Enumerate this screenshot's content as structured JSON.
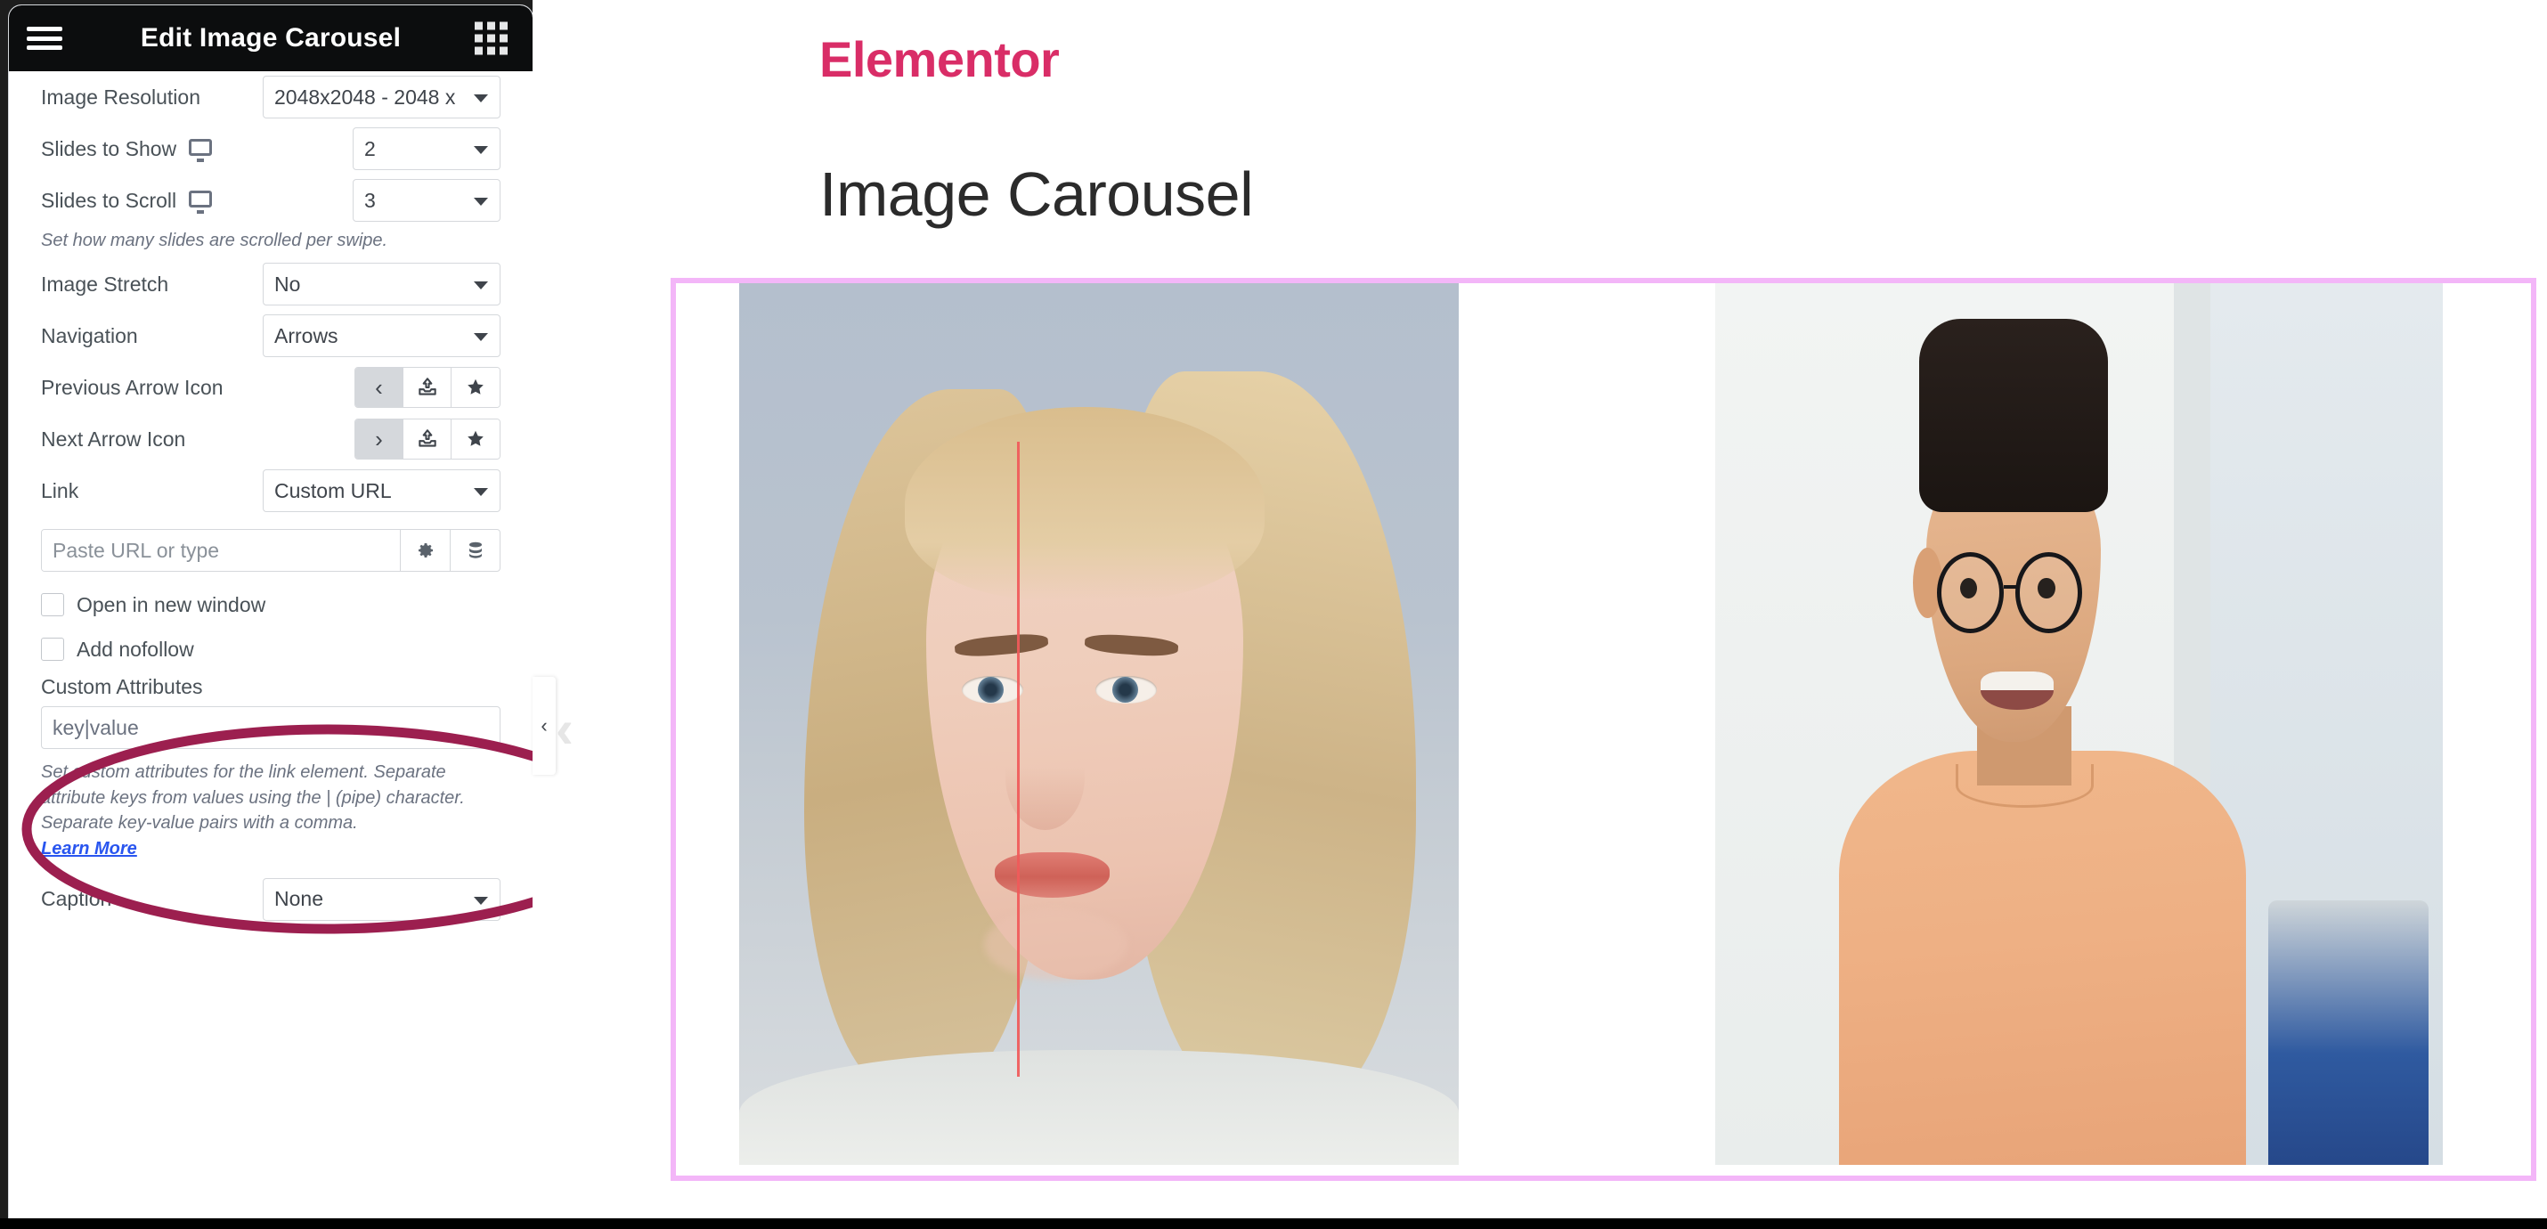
{
  "panel": {
    "header": {
      "title": "Edit Image Carousel",
      "menu_icon": "hamburger-icon",
      "apps_icon": "grid-apps-icon"
    },
    "controls": {
      "image_resolution": {
        "label": "Image Resolution",
        "value": "2048x2048 - 2048 x"
      },
      "slides_to_show": {
        "label": "Slides to Show",
        "value": "2",
        "device_icon": "desktop-monitor-icon"
      },
      "slides_to_scroll": {
        "label": "Slides to Scroll",
        "value": "3",
        "device_icon": "desktop-monitor-icon",
        "description": "Set how many slides are scrolled per swipe."
      },
      "image_stretch": {
        "label": "Image Stretch",
        "value": "No"
      },
      "navigation": {
        "label": "Navigation",
        "value": "Arrows"
      },
      "previous_arrow_icon": {
        "label": "Previous Arrow Icon",
        "selected_glyph": "‹",
        "upload_icon": "upload-icon",
        "library_icon": "star-icon"
      },
      "next_arrow_icon": {
        "label": "Next Arrow Icon",
        "selected_glyph": "›",
        "upload_icon": "upload-icon",
        "library_icon": "star-icon"
      },
      "link": {
        "label": "Link",
        "value": "Custom URL"
      },
      "url_field": {
        "placeholder": "Paste URL or type",
        "value": "",
        "settings_icon": "gear-icon",
        "dynamic_icon": "database-stack-icon"
      },
      "open_in_new_window": {
        "label": "Open in new window",
        "checked": false
      },
      "add_nofollow": {
        "label": "Add nofollow",
        "checked": false
      },
      "custom_attributes": {
        "label": "Custom Attributes",
        "placeholder": "key|value",
        "value": "",
        "description": "Set custom attributes for the link element. Separate attribute keys from values using the | (pipe) character. Separate key-value pairs with a comma.",
        "learn_more": "Learn More"
      },
      "caption": {
        "label": "Caption",
        "value": "None"
      }
    },
    "collapse_handle": "‹"
  },
  "preview": {
    "brand": "Elementor",
    "heading": "Image Carousel",
    "prev_arrow": "‹",
    "next_arrow": "›",
    "slides": [
      {
        "alt": "Blonde woman portrait with red vertical symmetry line"
      },
      {
        "alt": "Smiling man with glasses in peach sweater"
      }
    ]
  },
  "annotation": {
    "shape": "ellipse-highlight",
    "color": "#9c1f4f"
  },
  "colors": {
    "brand_pink": "#d92d67",
    "panel_header_bg": "#0c0d0e",
    "carousel_border": "#f3b6f8",
    "annotation": "#9c1f4f",
    "link_blue": "#2955ef"
  }
}
